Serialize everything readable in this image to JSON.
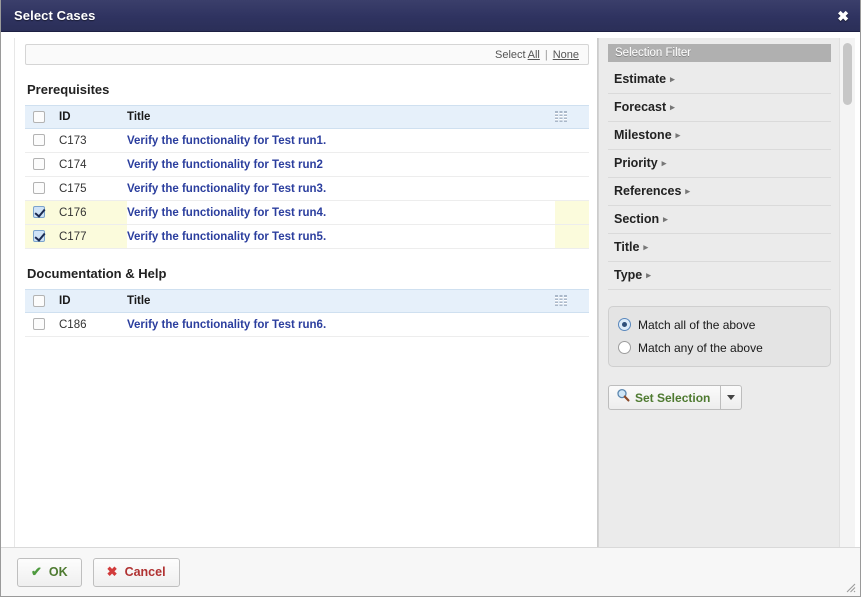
{
  "dialog": {
    "title": "Select Cases",
    "close_label": "✖"
  },
  "toolbar": {
    "select_label": "Select",
    "all_label": "All",
    "separator": "|",
    "none_label": "None"
  },
  "table_columns": {
    "id": "ID",
    "title": "Title",
    "columns_icon": "columns-icon"
  },
  "groups": [
    {
      "name": "Prerequisites",
      "rows": [
        {
          "id": "C173",
          "title": "Verify the functionality for Test run1.",
          "checked": false
        },
        {
          "id": "C174",
          "title": "Verify the functionality for Test run2",
          "checked": false
        },
        {
          "id": "C175",
          "title": "Verify the functionality for Test run3.",
          "checked": false
        },
        {
          "id": "C176",
          "title": "Verify the functionality for Test run4.",
          "checked": true
        },
        {
          "id": "C177",
          "title": "Verify the functionality for Test run5.",
          "checked": true
        }
      ]
    },
    {
      "name": "Documentation & Help",
      "rows": [
        {
          "id": "C186",
          "title": "Verify the functionality for Test run6.",
          "checked": false
        }
      ]
    }
  ],
  "sidebar": {
    "header": "Selection Filter",
    "chevron": "▸",
    "filters": [
      {
        "label": "Estimate"
      },
      {
        "label": "Forecast"
      },
      {
        "label": "Milestone"
      },
      {
        "label": "Priority"
      },
      {
        "label": "References"
      },
      {
        "label": "Section"
      },
      {
        "label": "Title"
      },
      {
        "label": "Type"
      }
    ],
    "match_options": [
      {
        "label": "Match all of the above",
        "selected": true
      },
      {
        "label": "Match any of the above",
        "selected": false
      }
    ],
    "set_selection": {
      "label": "Set Selection",
      "icon": "magnifier-icon",
      "dropdown_icon": "caret-down-icon"
    }
  },
  "footer": {
    "ok_label": "OK",
    "ok_glyph": "✔",
    "cancel_label": "Cancel",
    "cancel_glyph": "✖"
  },
  "colors": {
    "titlebar": "#2f3360",
    "link": "#2b3e9e",
    "selected_row": "#fbfbdc",
    "table_header": "#e6f0fa",
    "sidebar_bg": "#ebebeb",
    "filter_header": "#b0b0b0",
    "ok_green": "#4e7a30",
    "cancel_red": "#b03232"
  }
}
